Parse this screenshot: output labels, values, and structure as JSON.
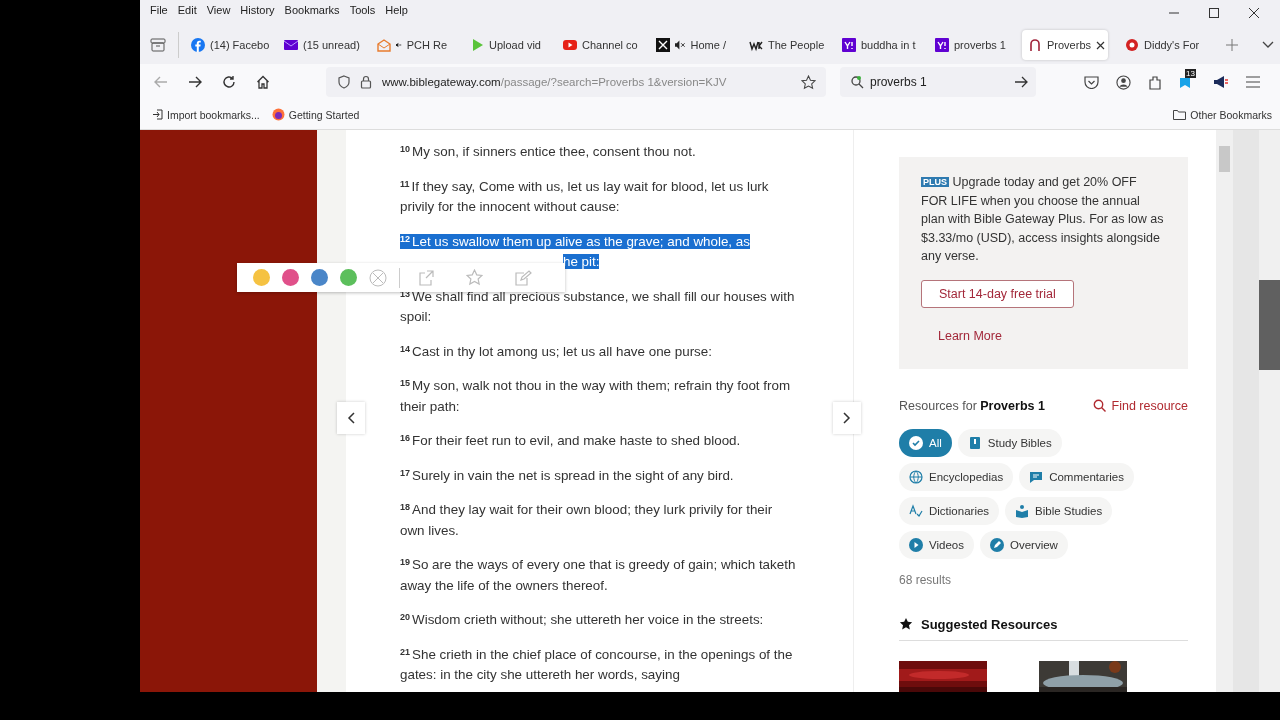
{
  "menu": [
    "File",
    "Edit",
    "View",
    "History",
    "Bookmarks",
    "Tools",
    "Help"
  ],
  "tabs": [
    {
      "label": "(14) Facebo",
      "kind": "facebook",
      "muted": false,
      "selected": false
    },
    {
      "label": "(15 unread)",
      "kind": "mail",
      "muted": false,
      "selected": false
    },
    {
      "label": "PCH Re",
      "kind": "pch",
      "muted": true,
      "selected": false
    },
    {
      "label": "Upload vid",
      "kind": "upload",
      "muted": false,
      "selected": false
    },
    {
      "label": "Channel co",
      "kind": "youtube",
      "muted": false,
      "selected": false
    },
    {
      "label": "Home /",
      "kind": "x",
      "muted": true,
      "selected": false
    },
    {
      "label": "The People",
      "kind": "wk",
      "muted": false,
      "selected": false
    },
    {
      "label": "buddha in t",
      "kind": "yahoo",
      "muted": false,
      "selected": false
    },
    {
      "label": "proverbs 1",
      "kind": "yahoo",
      "muted": false,
      "selected": false
    },
    {
      "label": "Proverbs",
      "kind": "gateway",
      "muted": false,
      "selected": true
    },
    {
      "label": "Diddy's For",
      "kind": "diddy",
      "muted": false,
      "selected": false
    }
  ],
  "address": {
    "host": "www.biblegateway.com",
    "path": "/passage/?search=Proverbs 1&version=KJV"
  },
  "search": {
    "value": "proverbs 1"
  },
  "extension_badge": "13",
  "bookmarks": [
    "Import bookmarks...",
    "Getting Started"
  ],
  "other_bookmarks": "Other Bookmarks",
  "verses": [
    {
      "number": "10",
      "text": "My son, if sinners entice thee, consent thou not.",
      "selected": false
    },
    {
      "number": "11",
      "text": "If they say, Come with us, let us lay wait for blood, let us lurk privily for the innocent without cause:",
      "selected": false
    },
    {
      "number": "12",
      "text": "Let us swallow them up alive as the grave; and whole, as",
      "tail": "he pit:",
      "selected": true
    },
    {
      "number": "13",
      "text": "We shall find all precious substance, we shall fill our houses with spoil:",
      "selected": false
    },
    {
      "number": "14",
      "text": "Cast in thy lot among us; let us all have one purse:",
      "selected": false
    },
    {
      "number": "15",
      "text": "My son, walk not thou in the way with them; refrain thy foot from their path:",
      "selected": false
    },
    {
      "number": "16",
      "text": "For their feet run to evil, and make haste to shed blood.",
      "selected": false
    },
    {
      "number": "17",
      "text": "Surely in vain the net is spread in the sight of any bird.",
      "selected": false
    },
    {
      "number": "18",
      "text": "And they lay wait for their own blood; they lurk privily for their own lives.",
      "selected": false
    },
    {
      "number": "19",
      "text": "So are the ways of every one that is greedy of gain; which taketh away the life of the owners thereof.",
      "selected": false
    },
    {
      "number": "20",
      "text": "Wisdom crieth without; she uttereth her voice in the streets:",
      "selected": false
    },
    {
      "number": "21",
      "text": "She crieth in the chief place of concourse, in the openings of the gates: in the city she uttereth her words, saying",
      "selected": false
    }
  ],
  "highlight_colors": [
    {
      "color": "#f5c242"
    },
    {
      "color": "#e0508a"
    },
    {
      "color": "#4a86c8"
    },
    {
      "color": "#5cbf5c"
    }
  ],
  "promo": {
    "badge": "PLUS",
    "text": "Upgrade today and get 20% OFF FOR LIFE when you choose the annual plan with Bible Gateway Plus. For as low as $3.33/mo (USD), access insights alongside any verse.",
    "button": "Start 14-day free trial",
    "link": "Learn More"
  },
  "resources": {
    "heading": "Resources for **Proverbs 1**",
    "find": "Find resource",
    "filters": [
      {
        "label": "All",
        "kind": "check",
        "selected": true
      },
      {
        "label": "Study Bibles",
        "kind": "book",
        "selected": false
      },
      {
        "label": "Encyclopedias",
        "kind": "globe",
        "selected": false
      },
      {
        "label": "Commentaries",
        "kind": "comment",
        "selected": false
      },
      {
        "label": "Dictionaries",
        "kind": "dictionary",
        "selected": false
      },
      {
        "label": "Bible Studies",
        "kind": "study",
        "selected": false
      },
      {
        "label": "Videos",
        "kind": "play",
        "selected": false
      },
      {
        "label": "Overview",
        "kind": "pencil",
        "selected": false
      }
    ],
    "count": "68 results"
  },
  "suggested": {
    "heading": "Suggested Resources"
  }
}
